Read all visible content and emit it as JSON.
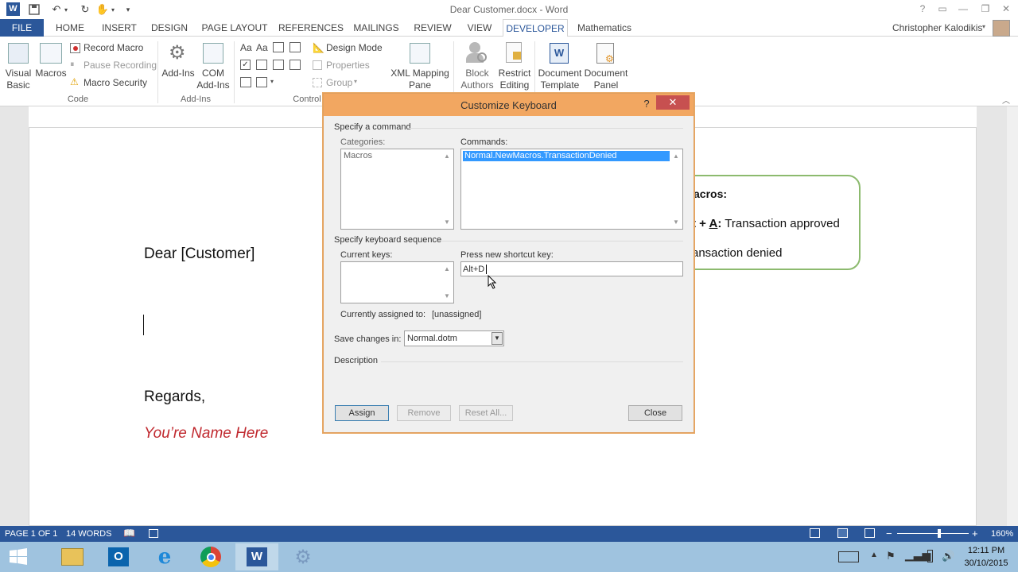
{
  "window": {
    "title": "Dear Customer.docx - Word",
    "help": "?",
    "user": "Christopher Kalodikis"
  },
  "tabs": [
    "FILE",
    "HOME",
    "INSERT",
    "DESIGN",
    "PAGE LAYOUT",
    "REFERENCES",
    "MAILINGS",
    "REVIEW",
    "VIEW",
    "DEVELOPER",
    "Mathematics"
  ],
  "ribbon": {
    "code": {
      "visual_basic_1": "Visual",
      "visual_basic_2": "Basic",
      "macros": "Macros",
      "record_macro": "Record Macro",
      "pause_recording": "Pause Recording",
      "macro_security": "Macro Security",
      "group": "Code"
    },
    "addins": {
      "addins": "Add-Ins",
      "com_1": "COM",
      "com_2": "Add-Ins",
      "group": "Add-Ins"
    },
    "controls": {
      "aa1": "Aa",
      "aa2": "Aa",
      "design_mode": "Design Mode",
      "properties": "Properties",
      "group_btn": "Group",
      "group": "Control"
    },
    "mapping": {
      "xml_1": "XML Mapping",
      "xml_2": "Pane"
    },
    "protect": {
      "block_1": "Block",
      "block_2": "Authors",
      "restrict_1": "Restrict",
      "restrict_2": "Editing"
    },
    "templates": {
      "doc_template_1": "Document",
      "doc_template_2": "Template",
      "doc_panel_1": "Document",
      "doc_panel_2": "Panel"
    }
  },
  "document": {
    "greeting": "Dear [Customer]",
    "closing": "Regards,",
    "signature": "You’re Name Here",
    "macros_box": {
      "heading": "acros:",
      "line1_keys": "t + ",
      "line1_key_a": "A",
      "line1_colon": ":",
      "line1_text": " Transaction approved",
      "line2_text": "ansaction denied"
    }
  },
  "dialog": {
    "title": "Customize Keyboard",
    "specify_command": "Specify a command",
    "categories_label": "Categories:",
    "categories": [
      "Macros"
    ],
    "commands_label": "Commands:",
    "commands": [
      "Normal.NewMacros.TransactionDenied"
    ],
    "specify_sequence": "Specify keyboard sequence",
    "current_keys_label": "Current keys:",
    "new_shortcut_label": "Press new shortcut key:",
    "new_shortcut_value": "Alt+D",
    "assigned_label": "Currently assigned to:",
    "assigned_value": "[unassigned]",
    "save_changes_label": "Save changes in:",
    "save_changes_value": "Normal.dotm",
    "description_label": "Description",
    "buttons": {
      "assign": "Assign",
      "remove": "Remove",
      "reset_all": "Reset All...",
      "close": "Close"
    }
  },
  "statusbar": {
    "page": "PAGE 1 OF 1",
    "words": "14 WORDS",
    "zoom": "160%",
    "zoom_level": 1.6
  },
  "taskbar": {
    "time": "12:11 PM",
    "date": "30/10/2015"
  },
  "colors": {
    "word_blue": "#2b579a",
    "dialog_title": "#f2a761",
    "signature_red": "#c0282e",
    "box_green": "#8cba6e",
    "taskbar": "#9fc3df"
  }
}
